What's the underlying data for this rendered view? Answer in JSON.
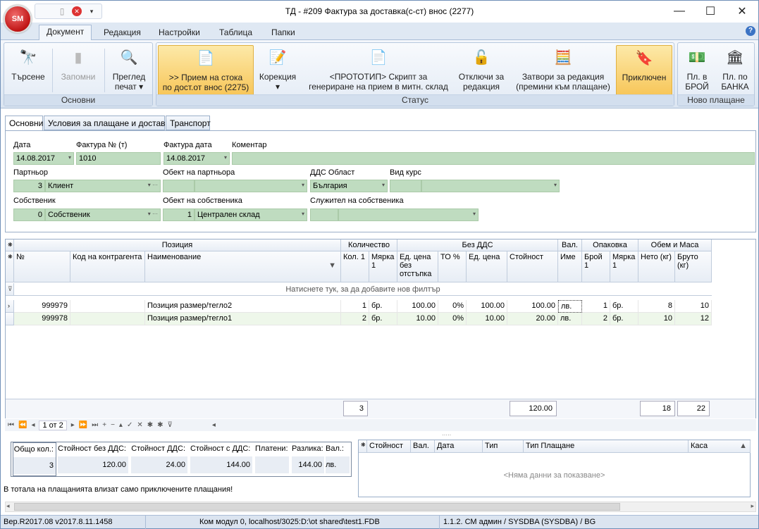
{
  "app": {
    "logo": "SM",
    "title": "ТД - #209 Фактура за доставка(с-ст) внос (2277)"
  },
  "window_controls": {
    "minimize": "—",
    "maximize": "☐",
    "close": "✕"
  },
  "ribbon_tabs": [
    "Документ",
    "Редакция",
    "Настройки",
    "Таблица",
    "Папки"
  ],
  "ribbon": {
    "groups": {
      "basic": "Основни",
      "status": "Статус",
      "new_payment": "Ново плащане"
    },
    "buttons": {
      "search": "Търсене",
      "remember": "Запомни",
      "preview1": "Преглед",
      "preview2": "печат",
      "receive1": ">> Прием на стока",
      "receive2": "по дост.от внос (2275)",
      "correction": "Корекция",
      "proto1": "<ПРОТОТИП> Скрипт за",
      "proto2": "генериране на прием в митн. склад",
      "unlock1": "Отключи за",
      "unlock2": "редакция",
      "close1": "Затвори за редакция",
      "close2": "(премини към плащане)",
      "finished": "Приключен",
      "paycash1": "Пл. в",
      "paycash2": "БРОЙ",
      "paybank1": "Пл. по",
      "paybank2": "БАНКА"
    }
  },
  "page_tabs": [
    "Основни",
    "Условия за плащане и доставка",
    "Транспорт"
  ],
  "form": {
    "date_label": "Дата",
    "date": "14.08.2017",
    "invoice_no_label": "Фактура № (т)",
    "invoice_no": "1010",
    "invoice_date_label": "Фактура дата",
    "invoice_date": "14.08.2017",
    "comment_label": "Коментар",
    "comment": "",
    "partner_label": "Партньор",
    "partner_id": "3",
    "partner": "Клиент",
    "partner_object_label": "Обект на партньора",
    "vat_region_label": "ДДС Област",
    "vat_region": "България",
    "rate_type_label": "Вид курс",
    "owner_label": "Собственик",
    "owner_id": "0",
    "owner": "Собственик",
    "owner_object_label": "Обект на собственика",
    "owner_object_id": "1",
    "owner_object": "Централен склад",
    "owner_employee_label": "Служител на собственика"
  },
  "grid": {
    "bands": [
      "Позиция",
      "Количество",
      "Без ДДС",
      "Вал.",
      "Опаковка",
      "Обем и Маса"
    ],
    "columns": [
      "№",
      "Код на контрагента",
      "Наименование",
      "Кол. 1",
      "Мярка 1",
      "Ед. цена без отстъпка",
      "ТО %",
      "Ед. цена",
      "Стойност",
      "Име",
      "Брой 1",
      "Мярка 1",
      "Нето (кг)",
      "Бруто (кг)"
    ],
    "filter_hint": "Натиснете тук, за да добавите нов филтър",
    "rows": [
      [
        "999979",
        "",
        "Позиция размер/тегло2",
        "1",
        "бр.",
        "100.00",
        "0%",
        "100.00",
        "100.00",
        "лв.",
        "1",
        "бр.",
        "8",
        "10"
      ],
      [
        "999978",
        "",
        "Позиция размер/тегло1",
        "2",
        "бр.",
        "10.00",
        "0%",
        "10.00",
        "20.00",
        "лв.",
        "2",
        "бр.",
        "10",
        "12"
      ]
    ],
    "totals": {
      "qty": "3",
      "value": "120.00",
      "net": "18",
      "gross": "22"
    }
  },
  "navigator": {
    "page": "1 от 2"
  },
  "summary": {
    "labels": [
      "Общо кол.:",
      "Стойност без ДДС:",
      "Стойност ДДС:",
      "Стойност с ДДС:",
      "Платени:",
      "Разлика:",
      "Вал.:"
    ],
    "values": [
      "3",
      "120.00",
      "24.00",
      "144.00",
      "",
      "144.00",
      "лв."
    ]
  },
  "payments": {
    "columns": [
      "Стойност",
      "Вал.",
      "Дата",
      "Тип",
      "Тип Плащане",
      "Каса"
    ],
    "empty": "<Няма данни за показване>"
  },
  "note": "В тотала на плащанията влизат само приключените плащания!",
  "status": {
    "version": "Вер.R2017.08 v2017.8.11.1458",
    "connection": "Ком модул 0, localhost/3025:D:\\ot shared\\test1.FDB",
    "user": "1.1.2. СМ админ / SYSDBA (SYSDBA) / BG"
  }
}
